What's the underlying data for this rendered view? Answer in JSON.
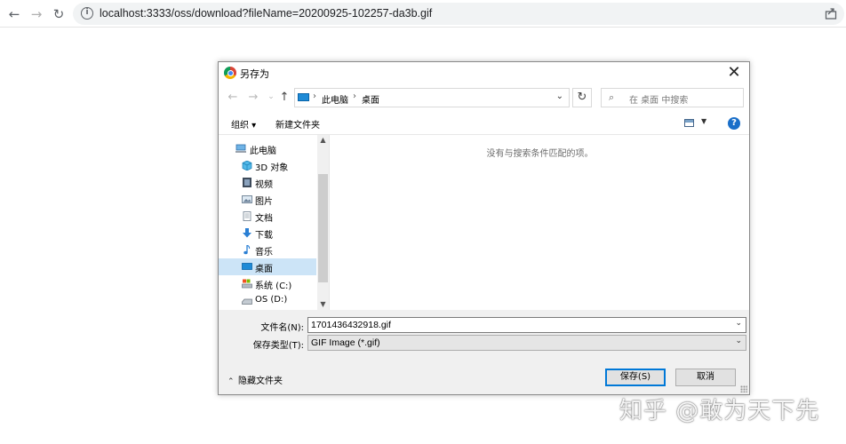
{
  "browser": {
    "url": "localhost:3333/oss/download?fileName=20200925-102257-da3b.gif",
    "back_icon": "arrow-left-icon",
    "forward_icon": "arrow-right-icon",
    "reload_icon": "reload-icon"
  },
  "dialog": {
    "title": "另存为",
    "close_glyph": "✕",
    "path": [
      "此电脑",
      "桌面"
    ],
    "search_placeholder": "在 桌面 中搜索",
    "toolbar": {
      "organize": "组织 ▾",
      "new_folder": "新建文件夹",
      "help": "?"
    },
    "nav_items": [
      {
        "label": "此电脑",
        "icon": "computer-icon",
        "selected": false
      },
      {
        "label": "3D 对象",
        "icon": "3d-objects-icon",
        "selected": false
      },
      {
        "label": "视频",
        "icon": "video-icon",
        "selected": false
      },
      {
        "label": "图片",
        "icon": "pictures-icon",
        "selected": false
      },
      {
        "label": "文档",
        "icon": "documents-icon",
        "selected": false
      },
      {
        "label": "下载",
        "icon": "download-icon",
        "selected": false
      },
      {
        "label": "音乐",
        "icon": "music-icon",
        "selected": false
      },
      {
        "label": "桌面",
        "icon": "desktop-icon",
        "selected": true
      },
      {
        "label": "系统 (C:)",
        "icon": "drive-c-icon",
        "selected": false
      },
      {
        "label": "OS (D:)",
        "icon": "drive-d-icon",
        "selected": false
      }
    ],
    "empty_message": "没有与搜索条件匹配的项。",
    "filename_label": "文件名(N):",
    "filename_value": "1701436432918.gif",
    "filetype_label": "保存类型(T):",
    "filetype_value": "GIF Image (*.gif)",
    "hide_folders": "隐藏文件夹",
    "save_button": "保存(S)",
    "cancel_button": "取消"
  },
  "watermark": "知乎 @敢为天下先"
}
